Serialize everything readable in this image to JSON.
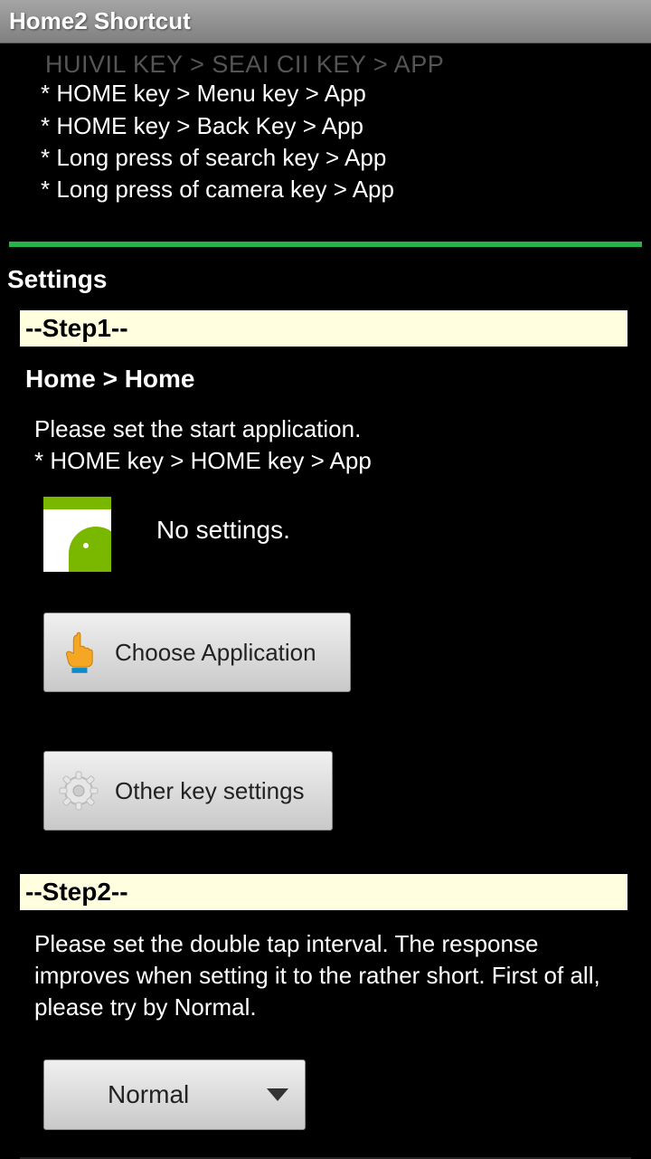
{
  "title": "Home2 Shortcut",
  "top_partial": "  HUIVIL KEY > SEAI CII KEY > APP",
  "top_list": [
    "* HOME key > Menu key > App",
    "* HOME key > Back Key > App",
    "* Long press of search key > App",
    "* Long press of camera key > App"
  ],
  "settings_header": "Settings",
  "step1": {
    "label": "--Step1--",
    "breadcrumb": "Home > Home",
    "desc_line1": "Please set the start application.",
    "desc_line2": " * HOME key > HOME key > App",
    "icon_label": "Android",
    "no_settings": "No settings.",
    "choose_btn": "Choose Application",
    "other_btn": "Other key settings"
  },
  "step2": {
    "label": "--Step2--",
    "desc": "Please set the double tap interval. The response improves when setting it to the rather short. First of all, please try by Normal.",
    "dropdown_value": "Normal"
  }
}
